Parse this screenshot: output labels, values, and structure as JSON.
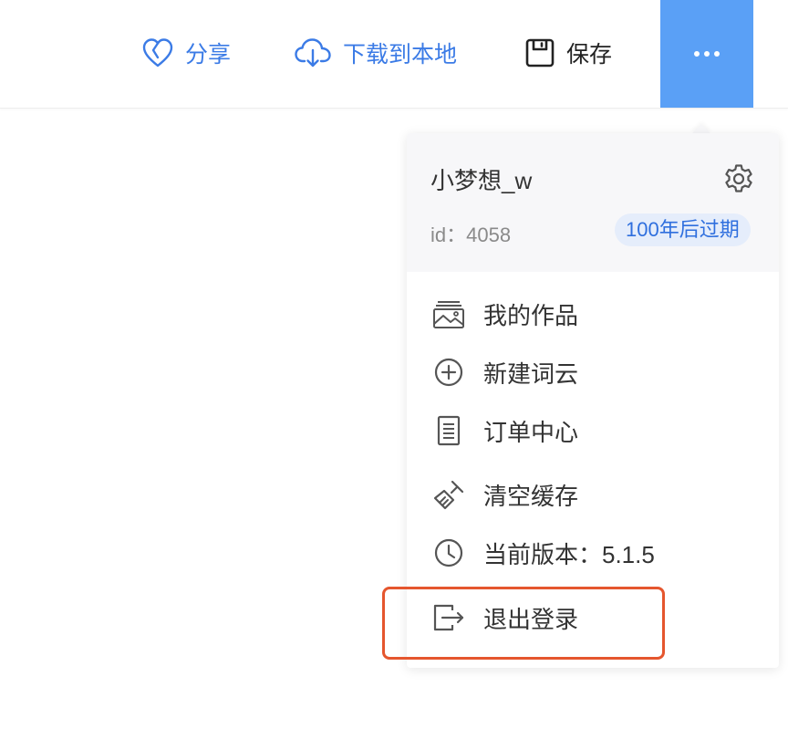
{
  "toolbar": {
    "share_label": "分享",
    "download_label": "下载到本地",
    "save_label": "保存",
    "accent_color": "#3b7be6",
    "more_button_color": "#5aa0f6"
  },
  "user": {
    "name": "小梦想_w",
    "id_text": "id：4058",
    "expiry_badge": "100年后过期"
  },
  "menu": {
    "items": [
      {
        "label": "我的作品",
        "icon": "picture-icon"
      },
      {
        "label": "新建词云",
        "icon": "plus-circle-icon"
      },
      {
        "label": "订单中心",
        "icon": "document-icon"
      },
      {
        "label": "清空缓存",
        "icon": "broom-icon"
      },
      {
        "label": "当前版本：5.1.5",
        "icon": "clock-icon"
      },
      {
        "label": "退出登录",
        "icon": "logout-icon"
      }
    ]
  },
  "highlight_color": "#e5562e"
}
